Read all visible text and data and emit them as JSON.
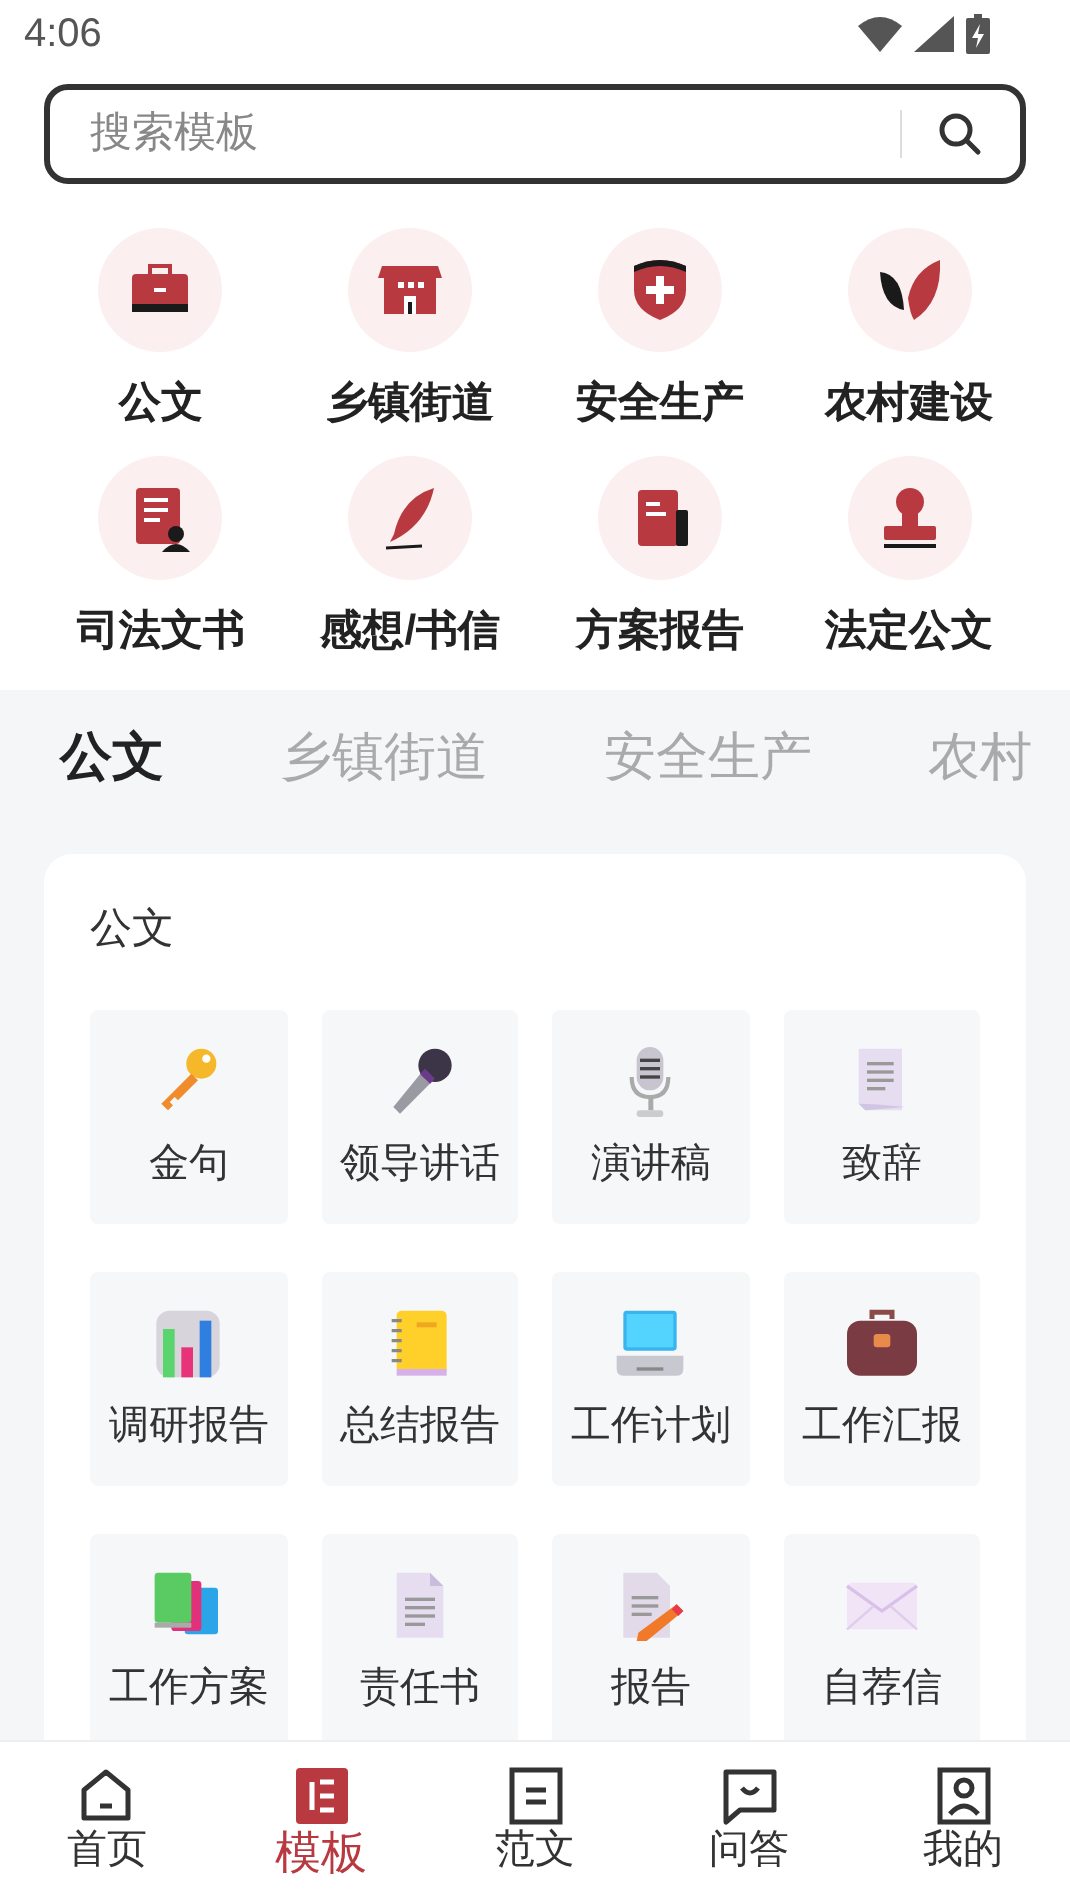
{
  "status_bar": {
    "time": "4:06"
  },
  "search": {
    "placeholder": "搜索模板"
  },
  "categories": [
    {
      "label": "公文"
    },
    {
      "label": "乡镇街道"
    },
    {
      "label": "安全生产"
    },
    {
      "label": "农村建设"
    },
    {
      "label": "司法文书"
    },
    {
      "label": "感想/书信"
    },
    {
      "label": "方案报告"
    },
    {
      "label": "法定公文"
    }
  ],
  "tabs": [
    {
      "label": "公文",
      "selected": true
    },
    {
      "label": "乡镇街道",
      "selected": false
    },
    {
      "label": "安全生产",
      "selected": false
    },
    {
      "label": "农村",
      "selected": false
    }
  ],
  "section": {
    "title": "公文",
    "items": [
      {
        "label": "金句"
      },
      {
        "label": "领导讲话"
      },
      {
        "label": "演讲稿"
      },
      {
        "label": "致辞"
      },
      {
        "label": "调研报告"
      },
      {
        "label": "总结报告"
      },
      {
        "label": "工作计划"
      },
      {
        "label": "工作汇报"
      },
      {
        "label": "工作方案"
      },
      {
        "label": "责任书"
      },
      {
        "label": "报告"
      },
      {
        "label": "自荐信"
      }
    ]
  },
  "bottom_nav": [
    {
      "label": "首页",
      "selected": false
    },
    {
      "label": "模板",
      "selected": true
    },
    {
      "label": "范文",
      "selected": false
    },
    {
      "label": "问答",
      "selected": false
    },
    {
      "label": "我的",
      "selected": false
    }
  ]
}
